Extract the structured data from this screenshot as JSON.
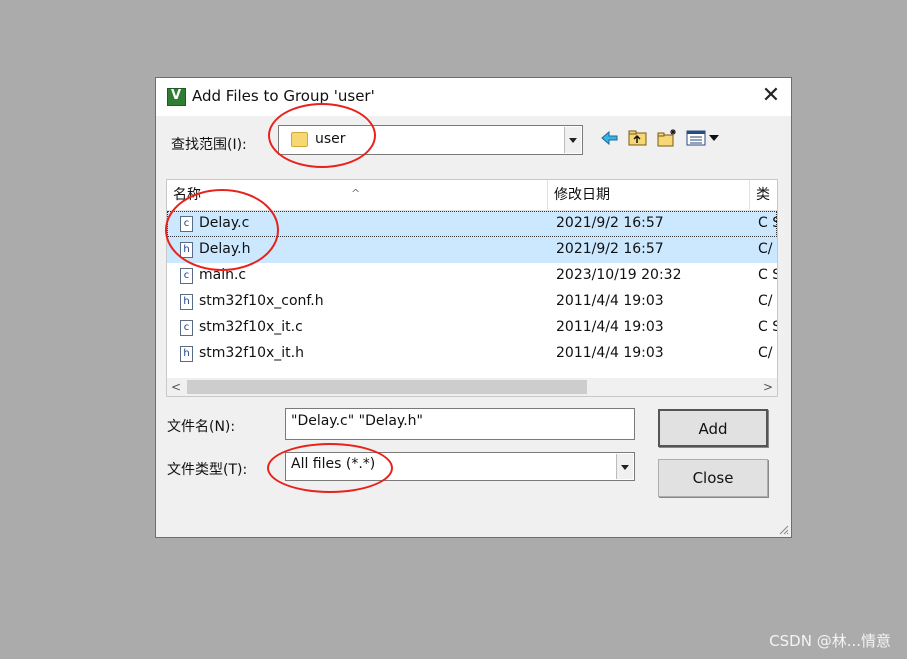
{
  "window": {
    "title": "Add Files to Group 'user'",
    "app_icon": "uvision-icon",
    "close_glyph": "✕"
  },
  "look_in": {
    "label": "查找范围(I):",
    "value": "user",
    "folder_icon": "folder-icon"
  },
  "toolbar": {
    "back_icon": "back-arrow-icon",
    "up_icon": "up-folder-icon",
    "new_folder_icon": "new-folder-icon",
    "view_menu_icon": "view-menu-icon"
  },
  "file_list": {
    "columns": [
      "名称",
      "修改日期",
      "类"
    ],
    "rows": [
      {
        "name": "Delay.c",
        "date": "2021/9/2 16:57",
        "type": "C S",
        "icon": "c",
        "selected": true
      },
      {
        "name": "Delay.h",
        "date": "2021/9/2 16:57",
        "type": "C/",
        "icon": "h",
        "selected": true
      },
      {
        "name": "main.c",
        "date": "2023/10/19 20:32",
        "type": "C S",
        "icon": "c",
        "selected": false
      },
      {
        "name": "stm32f10x_conf.h",
        "date": "2011/4/4 19:03",
        "type": "C/",
        "icon": "h",
        "selected": false
      },
      {
        "name": "stm32f10x_it.c",
        "date": "2011/4/4 19:03",
        "type": "C S",
        "icon": "c",
        "selected": false
      },
      {
        "name": "stm32f10x_it.h",
        "date": "2011/4/4 19:03",
        "type": "C/",
        "icon": "h",
        "selected": false
      }
    ]
  },
  "filename": {
    "label": "文件名(N):",
    "value": "\"Delay.c\" \"Delay.h\""
  },
  "filetype": {
    "label": "文件类型(T):",
    "value": "All files (*.*)"
  },
  "buttons": {
    "add": "Add",
    "close": "Close"
  },
  "annotation_color": "#e8221b",
  "watermark": "CSDN @林...情意"
}
